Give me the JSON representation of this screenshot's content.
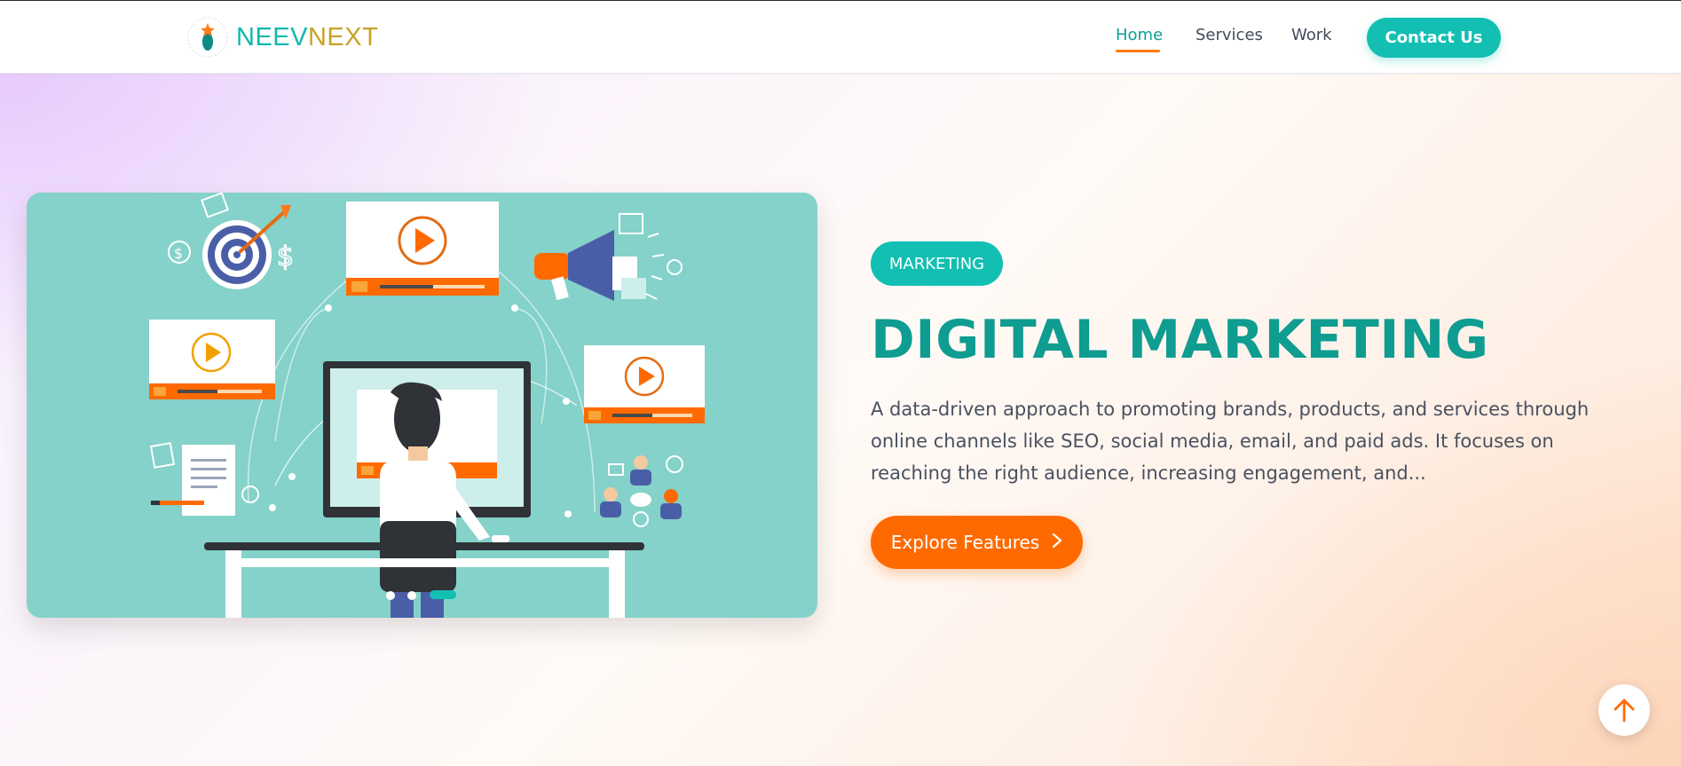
{
  "brand": {
    "name_part1": "NEEV",
    "name_part2": "NEXT"
  },
  "nav": {
    "home": "Home",
    "services": "Services",
    "work": "Work",
    "contact": "Contact Us"
  },
  "hero": {
    "badge": "MARKETING",
    "title": "DIGITAL MARKETING",
    "description": "A data-driven approach to promoting brands, products, and services through online channels like SEO, social media, email, and paid ads. It focuses on reaching the right audience, increasing engagement, and...",
    "cta": "Explore Features",
    "cta_icon": "chevron-right-icon"
  },
  "scroll_top": {
    "icon": "arrow-up-icon"
  },
  "colors": {
    "teal": "#12bfb2",
    "teal_dark": "#0f9c91",
    "orange": "#ff6a00",
    "illustration_bg": "#84d2c9"
  }
}
